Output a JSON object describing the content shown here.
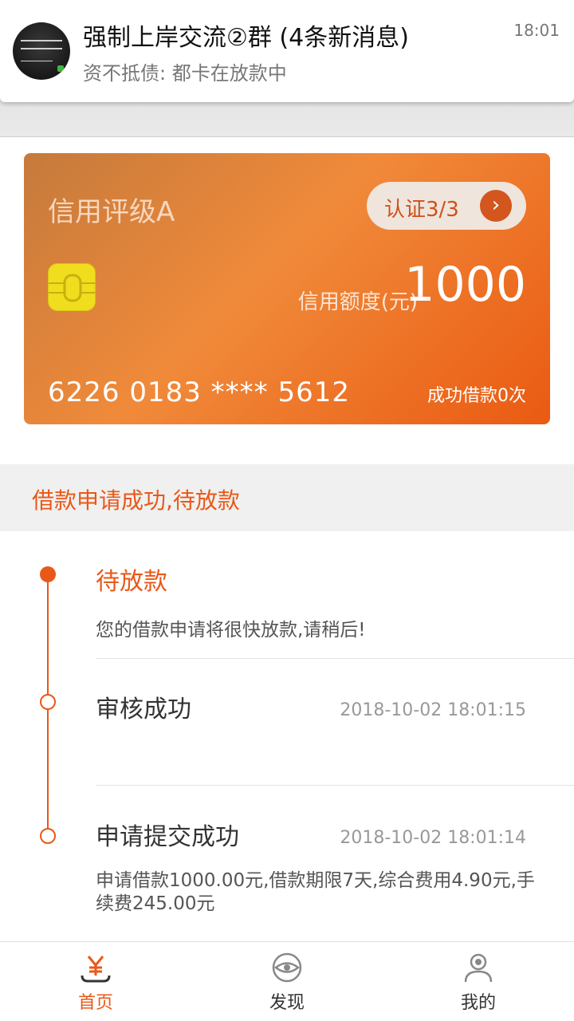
{
  "notification": {
    "title": "强制上岸交流②群 (4条新消息)",
    "message": "资不抵债: 都卡在放款中",
    "time": "18:01"
  },
  "card": {
    "rating": "信用评级A",
    "cert_label": "认证3/3",
    "limit_label": "信用额度(元)",
    "limit_value": "1000",
    "card_number": "6226 0183 **** 5612",
    "success_count": "成功借款0次"
  },
  "status": {
    "text": "借款申请成功,待放款"
  },
  "timeline": {
    "steps": [
      {
        "title": "待放款",
        "desc": "您的借款申请将很快放款,请稍后!"
      },
      {
        "title": "审核成功",
        "time": "2018-10-02 18:01:15"
      },
      {
        "title": "申请提交成功",
        "time": "2018-10-02 18:01:14",
        "desc": "申请借款1000.00元,借款期限7天,综合费用4.90元,手续费245.00元"
      }
    ]
  },
  "tabs": [
    {
      "label": "首页",
      "icon": "yuan-icon",
      "active": true
    },
    {
      "label": "发现",
      "icon": "eye-icon",
      "active": false
    },
    {
      "label": "我的",
      "icon": "user-icon",
      "active": false
    }
  ],
  "colors": {
    "accent": "#e95818",
    "card_start": "#c57a3c",
    "card_end": "#ea5a12",
    "chip": "#efdd1e"
  }
}
